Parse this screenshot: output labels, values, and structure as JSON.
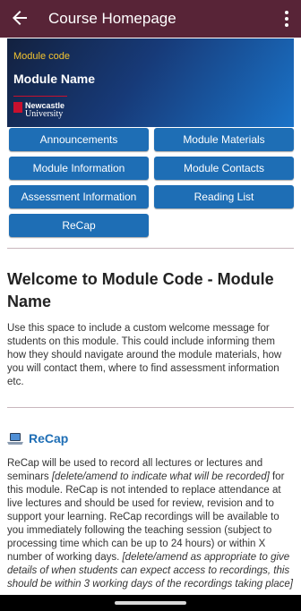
{
  "appbar": {
    "title": "Course Homepage",
    "back_icon": "arrow-left-icon",
    "menu_icon": "more-vertical-icon",
    "background": "#582437"
  },
  "banner": {
    "module_code": "Module code",
    "module_name": "Module Name",
    "logo_line1": "Newcastle",
    "logo_line2": "University"
  },
  "buttons": {
    "announcements": "Announcements",
    "module_materials": "Module Materials",
    "module_information": "Module Information",
    "module_contacts": "Module Contacts",
    "assessment_information": "Assessment Information",
    "reading_list": "Reading List",
    "recap": "ReCap",
    "color": "#1e6eb5"
  },
  "welcome": {
    "heading": "Welcome to Module Code - Module Name",
    "text": "Use this space to include a custom welcome message for students on this module. This could include informing them how they should navigate around the module materials, how you will contact them, where to find assessment information etc."
  },
  "recap_section": {
    "icon": "laptop-icon",
    "title": "ReCap",
    "p1": "ReCap will be used to record all lectures or lectures and seminars ",
    "p2_em": "[delete/amend to indicate what will be recorded]",
    "p3": " for this module. ReCap is not intended to replace attendance at live lectures and should be used for review, revision and to support your learning. ReCap recordings will be available to you immediately following the teaching session (subject to processing time which can be up to 24 hours) or within X number of working days. ",
    "p4_em": "[delete/amend as appropriate to give details of when students can expect access to recordings, this should be within 3 working days of the recordings taking place]"
  }
}
